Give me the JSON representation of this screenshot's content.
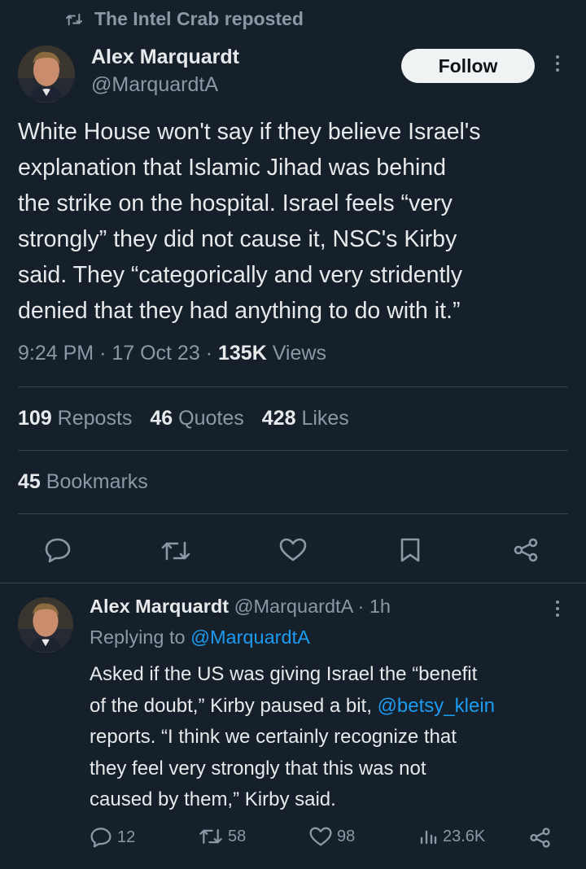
{
  "repost": {
    "label": "The Intel Crab reposted",
    "icon": "repost-icon"
  },
  "tweet": {
    "author_name": "Alex Marquardt",
    "author_handle": "@MarquardtA",
    "follow_label": "Follow",
    "text_lines": [
      "White House won't say if they believe Israel's",
      "explanation that Islamic Jihad was behind",
      "the strike on the hospital. Israel feels “very",
      "strongly” they did not cause it, NSC's Kirby",
      "said. They “categorically and very stridently",
      "denied that they had anything to do with it.”"
    ],
    "time": "9:24 PM",
    "date": "17 Oct 23",
    "views_count": "135K",
    "views_label": "Views",
    "sep": "·",
    "reposts_count": "109",
    "reposts_label": "Reposts",
    "quotes_count": "46",
    "quotes_label": "Quotes",
    "likes_count": "428",
    "likes_label": "Likes",
    "bookmarks_count": "45",
    "bookmarks_label": "Bookmarks",
    "actions": [
      "reply-icon",
      "repost-icon",
      "like-icon",
      "bookmark-icon",
      "share-icon"
    ]
  },
  "reply": {
    "author_name": "Alex Marquardt",
    "author_handle": "@MarquardtA",
    "sep": "·",
    "time": "1h",
    "replying_prefix": "Replying to",
    "replying_handle": "@MarquardtA",
    "line1": "Asked if the US was giving Israel the “benefit",
    "line2_pre": "of the doubt,” Kirby paused a bit, ",
    "line2_mention": "@betsy_klein",
    "line3": "reports. “I think we certainly recognize that",
    "line4": "they feel very strongly that this was not",
    "line5": "caused by them,” Kirby said.",
    "reply_count": "12",
    "repost_count": "58",
    "like_count": "98",
    "views_count": "23.6K"
  },
  "colors": {
    "background": "#15202b",
    "text": "#e7e9ea",
    "muted": "#8b98a5",
    "link": "#1d9bf0",
    "divider": "#38444d"
  }
}
